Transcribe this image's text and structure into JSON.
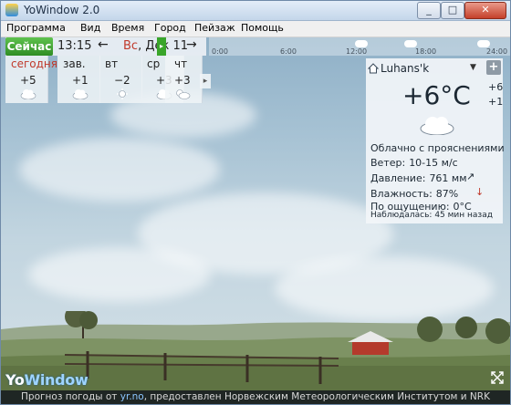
{
  "window": {
    "title": "YoWindow 2.0"
  },
  "menu": [
    "Программа",
    "Вид",
    "Время",
    "Город",
    "Пейзаж",
    "Помощь"
  ],
  "topbar": {
    "now_label": "Сейчас",
    "time": "13:15",
    "prev_arrow": "←",
    "date_dow": "Вс",
    "date_rest": ", Дек 11",
    "next_arrow": "→"
  },
  "timeline": {
    "labels": [
      "0:00",
      "6:00",
      "12:00",
      "18:00",
      "24:00"
    ],
    "handle_icon": "▸"
  },
  "forecast": [
    {
      "name": "сегодня",
      "temp": "+5",
      "icon": "cloud-icon"
    },
    {
      "name": "зав.",
      "temp": "+1",
      "icon": "cloud-icon"
    },
    {
      "name": "вт",
      "temp": "−2",
      "icon": "sun-icon"
    },
    {
      "name": "ср",
      "temp": "+3",
      "icon": "cloud-icon"
    },
    {
      "name": "чт",
      "temp": "+3",
      "icon": "partly-cloudy-icon"
    }
  ],
  "forecast_next": "▸",
  "panel": {
    "city": "Luhans'k",
    "dropdown": "▼",
    "plus": "+",
    "temp": "+6°C",
    "hi": "+6",
    "lo": "+1",
    "description": "Облачно с прояснениями",
    "wind_label": "Ветер:",
    "wind_value": "10-15 м/с",
    "wind_arrow": "↗",
    "pressure_label": "Давление:",
    "pressure_value": "761 мм",
    "pressure_arrow": "↓",
    "humidity_label": "Влажность:",
    "humidity_value": "87%",
    "feels_label": "По ощущению:",
    "feels_value": "0°C",
    "observed": "Наблюдалась: 45 мин назад"
  },
  "footer": {
    "prefix": "Прогноз погоды от",
    "link": "yr.no",
    "suffix": ", предоставлен Норвежским Метеорологическим Институтом и NRK"
  },
  "logo": {
    "yo": "Yo",
    "window": "Window"
  },
  "colors": {
    "now_green": "#39a52a",
    "today_red": "#c0392b",
    "link": "#8cc6ff"
  }
}
